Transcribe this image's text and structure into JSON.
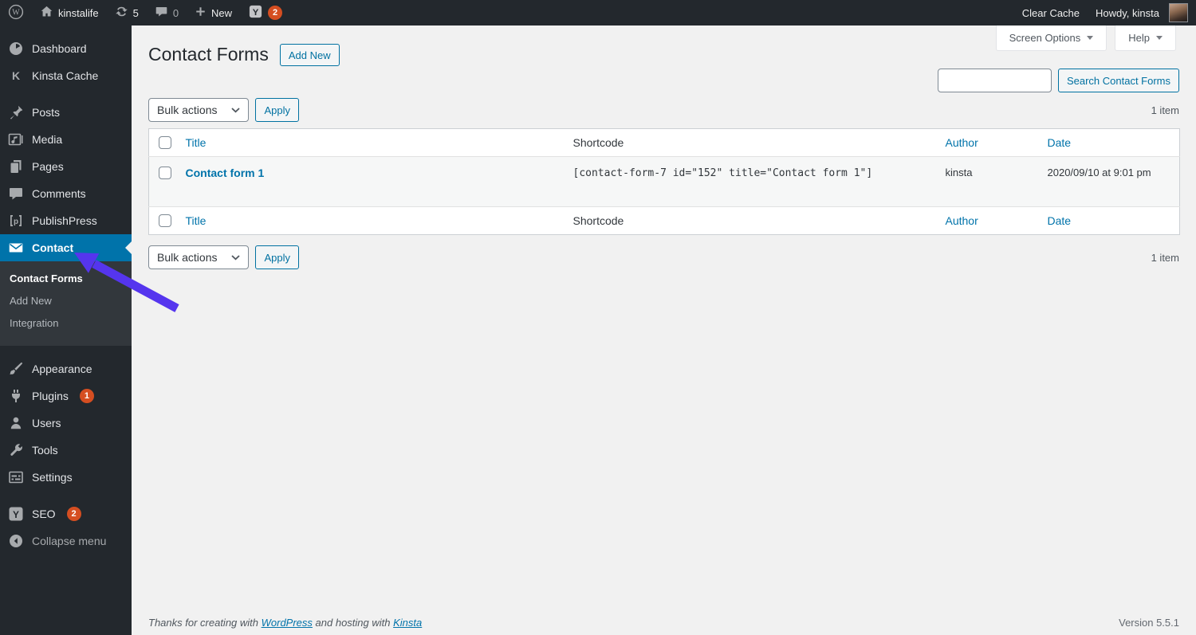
{
  "colors": {
    "accent_blue": "#0073aa",
    "menu_dark": "#23282d",
    "submenu_dark": "#32373c",
    "badge_orange": "#d54e21",
    "annotation_arrow_purple": "#5535ee",
    "content_bg": "#f1f1f1"
  },
  "admin_bar": {
    "site_name": "kinstalife",
    "update_count": "5",
    "comment_count": "0",
    "new_label": "New",
    "yoast_badge": "2",
    "clear_cache_label": "Clear Cache",
    "howdy_label": "Howdy, kinsta"
  },
  "sidebar": {
    "items": [
      {
        "label": "Dashboard"
      },
      {
        "label": "Kinsta Cache"
      },
      {
        "label": "Posts"
      },
      {
        "label": "Media"
      },
      {
        "label": "Pages"
      },
      {
        "label": "Comments"
      },
      {
        "label": "PublishPress"
      },
      {
        "label": "Contact"
      },
      {
        "label": "Appearance"
      },
      {
        "label": "Plugins"
      },
      {
        "label": "Users"
      },
      {
        "label": "Tools"
      },
      {
        "label": "Settings"
      },
      {
        "label": "SEO"
      }
    ],
    "plugins_badge": "1",
    "seo_badge": "2",
    "submenu": [
      "Contact Forms",
      "Add New",
      "Integration"
    ],
    "collapse_label": "Collapse menu"
  },
  "page": {
    "title": "Contact Forms",
    "add_new_label": "Add New",
    "screen_options_label": "Screen Options",
    "help_label": "Help",
    "search_button_label": "Search Contact Forms",
    "item_count": "1 item",
    "bulk_actions_label": "Bulk actions",
    "apply_label": "Apply"
  },
  "table": {
    "columns": {
      "title": "Title",
      "shortcode": "Shortcode",
      "author": "Author",
      "date": "Date"
    },
    "rows": [
      {
        "title": "Contact form 1",
        "shortcode": "[contact-form-7 id=\"152\" title=\"Contact form 1\"]",
        "author": "kinsta",
        "date": "2020/09/10 at 9:01 pm"
      }
    ]
  },
  "footer": {
    "thanks_prefix": "Thanks for creating with ",
    "wordpress_link": "WordPress",
    "thanks_middle": " and hosting with ",
    "kinsta_link": "Kinsta",
    "version": "Version 5.5.1"
  }
}
